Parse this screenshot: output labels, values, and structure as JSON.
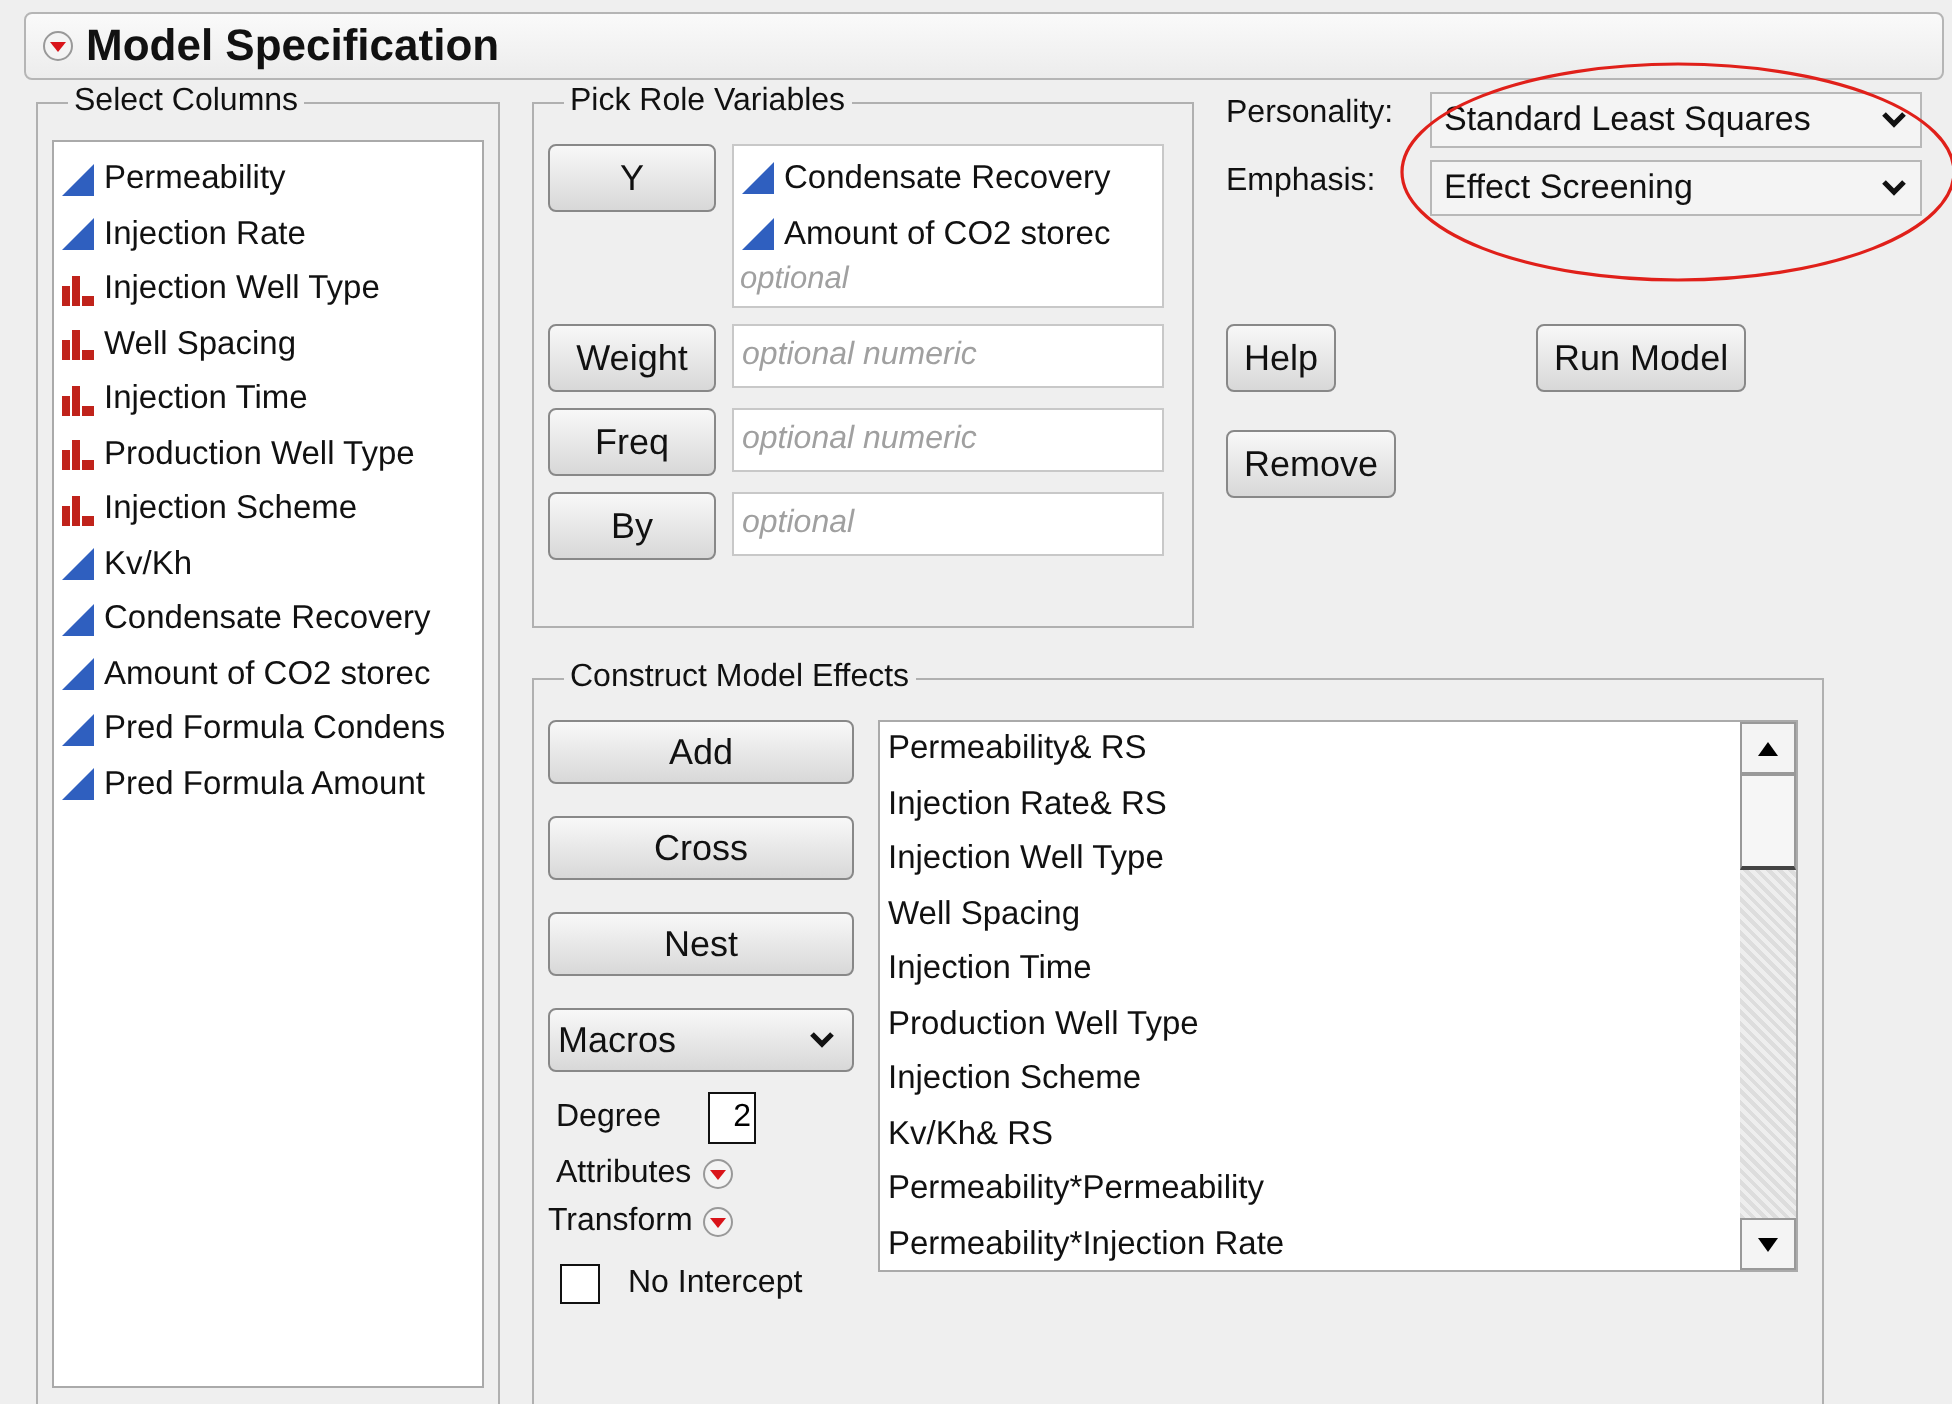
{
  "title": "Model Specification",
  "select_columns": {
    "label": "Select Columns",
    "columns": [
      {
        "name": "Permeability",
        "kind": "continuous"
      },
      {
        "name": "Injection Rate",
        "kind": "continuous"
      },
      {
        "name": "Injection Well Type",
        "kind": "nominal"
      },
      {
        "name": "Well Spacing",
        "kind": "nominal"
      },
      {
        "name": "Injection Time",
        "kind": "nominal"
      },
      {
        "name": "Production Well Type",
        "kind": "nominal"
      },
      {
        "name": "Injection Scheme",
        "kind": "nominal"
      },
      {
        "name": "Kv/Kh",
        "kind": "continuous"
      },
      {
        "name": "Condensate Recovery",
        "kind": "continuous"
      },
      {
        "name": "Amount of CO2 storec",
        "kind": "continuous"
      },
      {
        "name": "Pred Formula Condens",
        "kind": "continuous"
      },
      {
        "name": "Pred Formula Amount",
        "kind": "continuous"
      }
    ]
  },
  "pick_role_variables": {
    "label": "Pick Role Variables",
    "roles": [
      {
        "button": "Y",
        "variables": [
          {
            "name": "Condensate Recovery",
            "kind": "continuous"
          },
          {
            "name": "Amount of CO2 storec",
            "kind": "continuous"
          }
        ],
        "placeholder": "optional"
      },
      {
        "button": "Weight",
        "placeholder": "optional numeric"
      },
      {
        "button": "Freq",
        "placeholder": "optional numeric"
      },
      {
        "button": "By",
        "placeholder": "optional"
      }
    ]
  },
  "personality": {
    "label": "Personality:",
    "value": "Standard Least Squares"
  },
  "emphasis": {
    "label": "Emphasis:",
    "value": "Effect Screening"
  },
  "action_rows": [
    [
      "Help",
      "Run Model"
    ],
    [
      "Remove"
    ]
  ],
  "construct_model_effects": {
    "label": "Construct Model Effects",
    "buttons": [
      "Add",
      "Cross",
      "Nest"
    ],
    "macros": "Macros",
    "degree": {
      "label": "Degree",
      "value": "2"
    },
    "attributes": "Attributes",
    "transform": "Transform",
    "effects": [
      "Permeability& RS",
      "Injection Rate& RS",
      "Injection Well Type",
      "Well Spacing",
      "Injection Time",
      "Production Well Type",
      "Injection Scheme",
      "Kv/Kh& RS",
      "Permeability*Permeability",
      "Permeability*Injection Rate"
    ],
    "no_intercept": {
      "label": "No Intercept",
      "checked": false
    }
  }
}
